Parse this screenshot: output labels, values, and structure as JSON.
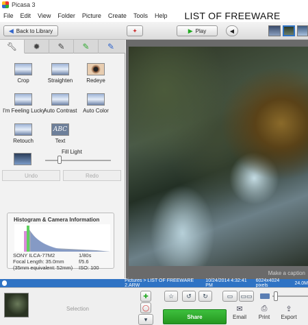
{
  "window": {
    "title": "Picasa 3",
    "brand": "LIST OF FREEWARE"
  },
  "menu": [
    "File",
    "Edit",
    "View",
    "Folder",
    "Picture",
    "Create",
    "Tools",
    "Help"
  ],
  "toolbar": {
    "back_label": "Back to Library",
    "play_label": "Play"
  },
  "tools": [
    {
      "label": "Crop"
    },
    {
      "label": "Straighten"
    },
    {
      "label": "Redeye"
    },
    {
      "label": "I'm Feeling Lucky"
    },
    {
      "label": "Auto Contrast"
    },
    {
      "label": "Auto Color"
    },
    {
      "label": "Retouch"
    },
    {
      "label": "Text"
    }
  ],
  "fill_light": {
    "label": "Fill Light",
    "value": 0
  },
  "undo_label": "Undo",
  "redo_label": "Redo",
  "histogram": {
    "title": "Histogram & Camera Information",
    "camera": "SONY ILCA-77M2",
    "focal_length": "Focal Length: 35.0mm",
    "equivalent": "(35mm equivalent: 52mm)",
    "shutter": "1/80s",
    "aperture": "f/5.6",
    "iso": "ISO: 100"
  },
  "caption_placeholder": "Make a caption",
  "status": {
    "path": "Pictures > LIST OF FREEWARE 2.ARW",
    "date": "10/24/2014 4:32:41 PM",
    "dimensions": "6024x4024 pixels",
    "size": "24.0M"
  },
  "bottom": {
    "selection_label": "Selection",
    "share_label": "Share",
    "email_label": "Email",
    "print_label": "Print",
    "export_label": "Export"
  },
  "colors": {
    "status_bar": "#2f73c4",
    "share_button": "#2fa62f"
  }
}
